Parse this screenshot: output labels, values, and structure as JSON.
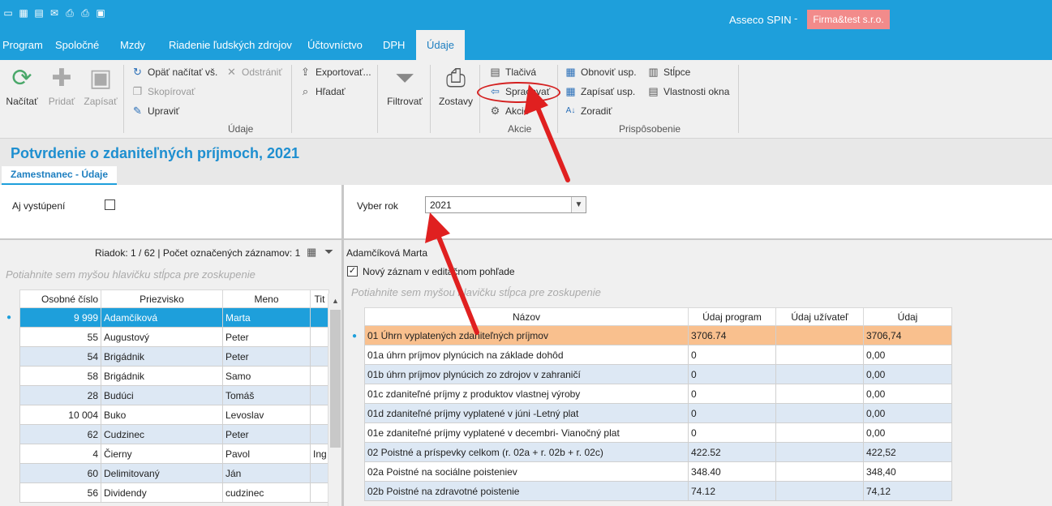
{
  "app": {
    "name": "Asseco SPIN",
    "separator": "-",
    "company": "Firma&test s.r.o."
  },
  "menu": {
    "tabs": [
      {
        "label": "Program"
      },
      {
        "label": "Spoločné"
      },
      {
        "label": "Mzdy"
      },
      {
        "label": "Riadenie ľudských zdrojov"
      },
      {
        "label": "Účtovníctvo"
      },
      {
        "label": "DPH"
      },
      {
        "label": "Údaje"
      }
    ],
    "active": "Údaje"
  },
  "ribbon": {
    "nacitat": "Načítať",
    "pridat": "Pridať",
    "zapisat": "Zapísať",
    "opat_nacitat": "Opäť načítať vš.",
    "odstranit": "Odstrániť",
    "skopirovat": "Skopírovať",
    "upravit": "Upraviť",
    "exportovat": "Exportovať...",
    "hladat": "Hľadať",
    "filtrovat": "Filtrovať",
    "zostavy": "Zostavy",
    "tlaciva": "Tlačivá",
    "spracovat": "Spracovať",
    "akcie": "Akcie",
    "obnovit_usp": "Obnoviť usp.",
    "zapisat_usp": "Zapísať usp.",
    "zoradit": "Zoradiť",
    "stlpce": "Stĺpce",
    "vlastnosti_okna": "Vlastnosti okna",
    "group_udaje": "Údaje",
    "group_akcie": "Akcie",
    "group_prisposobenie": "Prispôsobenie"
  },
  "form": {
    "title": "Potvrdenie o zdaniteľných príjmoch, 2021",
    "subtab": "Zamestnanec - Údaje",
    "aj_vystupeni": "Aj vystúpení",
    "vyber_rok_label": "Vyber rok",
    "vyber_rok_value": "2021"
  },
  "left_grid": {
    "info": "Riadok: 1 / 62 | Počet označených záznamov: 1",
    "group_hint": "Potiahnite sem myšou hlavičku stĺpca pre zoskupenie",
    "columns": [
      "Osobné číslo",
      "Priezvisko",
      "Meno",
      "Tit"
    ],
    "rows": [
      {
        "cislo": "9 999",
        "priezvisko": "Adamčíková",
        "meno": "Marta",
        "tit": ""
      },
      {
        "cislo": "55",
        "priezvisko": "Augustový",
        "meno": "Peter",
        "tit": ""
      },
      {
        "cislo": "54",
        "priezvisko": "Brigádnik",
        "meno": "Peter",
        "tit": ""
      },
      {
        "cislo": "58",
        "priezvisko": "Brigádnik",
        "meno": "Samo",
        "tit": ""
      },
      {
        "cislo": "28",
        "priezvisko": "Budúci",
        "meno": "Tomáš",
        "tit": ""
      },
      {
        "cislo": "10 004",
        "priezvisko": "Buko",
        "meno": "Levoslav",
        "tit": ""
      },
      {
        "cislo": "62",
        "priezvisko": "Cudzinec",
        "meno": "Peter",
        "tit": ""
      },
      {
        "cislo": "4",
        "priezvisko": "Čierny",
        "meno": "Pavol",
        "tit": "Ing"
      },
      {
        "cislo": "60",
        "priezvisko": "Delimitovaný",
        "meno": "Ján",
        "tit": ""
      },
      {
        "cislo": "56",
        "priezvisko": "Dividendy",
        "meno": "cudzinec",
        "tit": ""
      }
    ]
  },
  "right_grid": {
    "employee": "Adamčíková Marta",
    "new_record": "Nový záznam v editačnom pohľade",
    "group_hint": "Potiahnite sem myšou hlavičku stĺpca pre zoskupenie",
    "columns": [
      "Názov",
      "Údaj program",
      "Údaj užívateľ",
      "Údaj"
    ],
    "rows": [
      {
        "nazov": "01 Úhrn vyplatených zdaniteľných príjmov",
        "program": "3706.74",
        "uzivatel": "",
        "udaj": "3706,74"
      },
      {
        "nazov": "01a úhrn príjmov plynúcich na základe dohôd",
        "program": "0",
        "uzivatel": "",
        "udaj": "0,00"
      },
      {
        "nazov": "01b  úhrn príjmov plynúcich zo zdrojov v zahraničí",
        "program": "0",
        "uzivatel": "",
        "udaj": "0,00"
      },
      {
        "nazov": "01c  zdaniteľné príjmy z produktov vlastnej výroby",
        "program": "0",
        "uzivatel": "",
        "udaj": "0,00"
      },
      {
        "nazov": "01d zdaniteľné príjmy vyplatené v júni -Letný plat",
        "program": "0",
        "uzivatel": "",
        "udaj": "0,00"
      },
      {
        "nazov": "01e zdaniteľné príjmy vyplatené v decembri- Vianočný plat",
        "program": "0",
        "uzivatel": "",
        "udaj": "0,00"
      },
      {
        "nazov": "02 Poistné a príspevky celkom  (r. 02a + r. 02b + r. 02c)",
        "program": "422.52",
        "uzivatel": "",
        "udaj": "422,52"
      },
      {
        "nazov": "02a Poistné na sociálne poisteniev",
        "program": "348.40",
        "uzivatel": "",
        "udaj": "348,40"
      },
      {
        "nazov": "02b Poistné na zdravotné poistenie",
        "program": "74.12",
        "uzivatel": "",
        "udaj": "74,12"
      }
    ]
  },
  "colors": {
    "accent": "#1e9fdb",
    "company_badge": "#f28b8b",
    "selected_row_left": "#1e9fdb",
    "selected_row_right": "#f9c08e",
    "alt_row": "#dde8f4",
    "annotation": "#e02020"
  }
}
